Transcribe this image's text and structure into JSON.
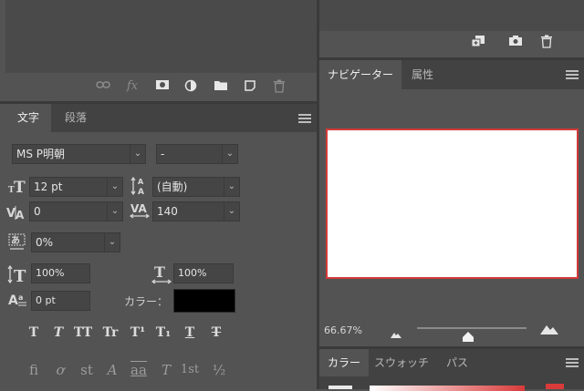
{
  "layers_footer": {
    "icons": [
      "link-icon",
      "fx-icon",
      "mask-icon",
      "adjustment-icon",
      "folder-icon",
      "new-layer-icon",
      "trash-icon"
    ],
    "fx_label": "fx"
  },
  "character_panel": {
    "tabs": [
      {
        "label": "文字",
        "active": true
      },
      {
        "label": "段落",
        "active": false
      }
    ],
    "font_family": "MS P明朝",
    "font_style": "-",
    "font_size": "12 pt",
    "leading": "(自動)",
    "kerning": "0",
    "tracking": "140",
    "tsume": "0%",
    "vertical_scale": "100%",
    "horizontal_scale": "100%",
    "baseline_shift": "0 pt",
    "color_label": "カラー：",
    "color_value": "#000000",
    "style_buttons": [
      "T",
      "T",
      "TT",
      "Tr",
      "T¹",
      "T₁",
      "T",
      "T"
    ],
    "ligature_buttons": [
      "ﬁ",
      "ơ",
      "st",
      "A",
      "aa",
      "T",
      "1st",
      "½"
    ]
  },
  "navigator_panel": {
    "tabs": [
      {
        "label": "ナビゲーター",
        "active": true
      },
      {
        "label": "属性",
        "active": false
      }
    ],
    "zoom": "66.67%",
    "zoom_slider_fraction": 0.47
  },
  "color_panel": {
    "tabs": [
      {
        "label": "カラー",
        "active": true
      },
      {
        "label": "スウォッチ",
        "active": false
      },
      {
        "label": "パス",
        "active": false
      }
    ]
  },
  "colors": {
    "panel_bg": "#535353",
    "tabbar_bg": "#424242",
    "navigator_border": "#d23a3a"
  }
}
